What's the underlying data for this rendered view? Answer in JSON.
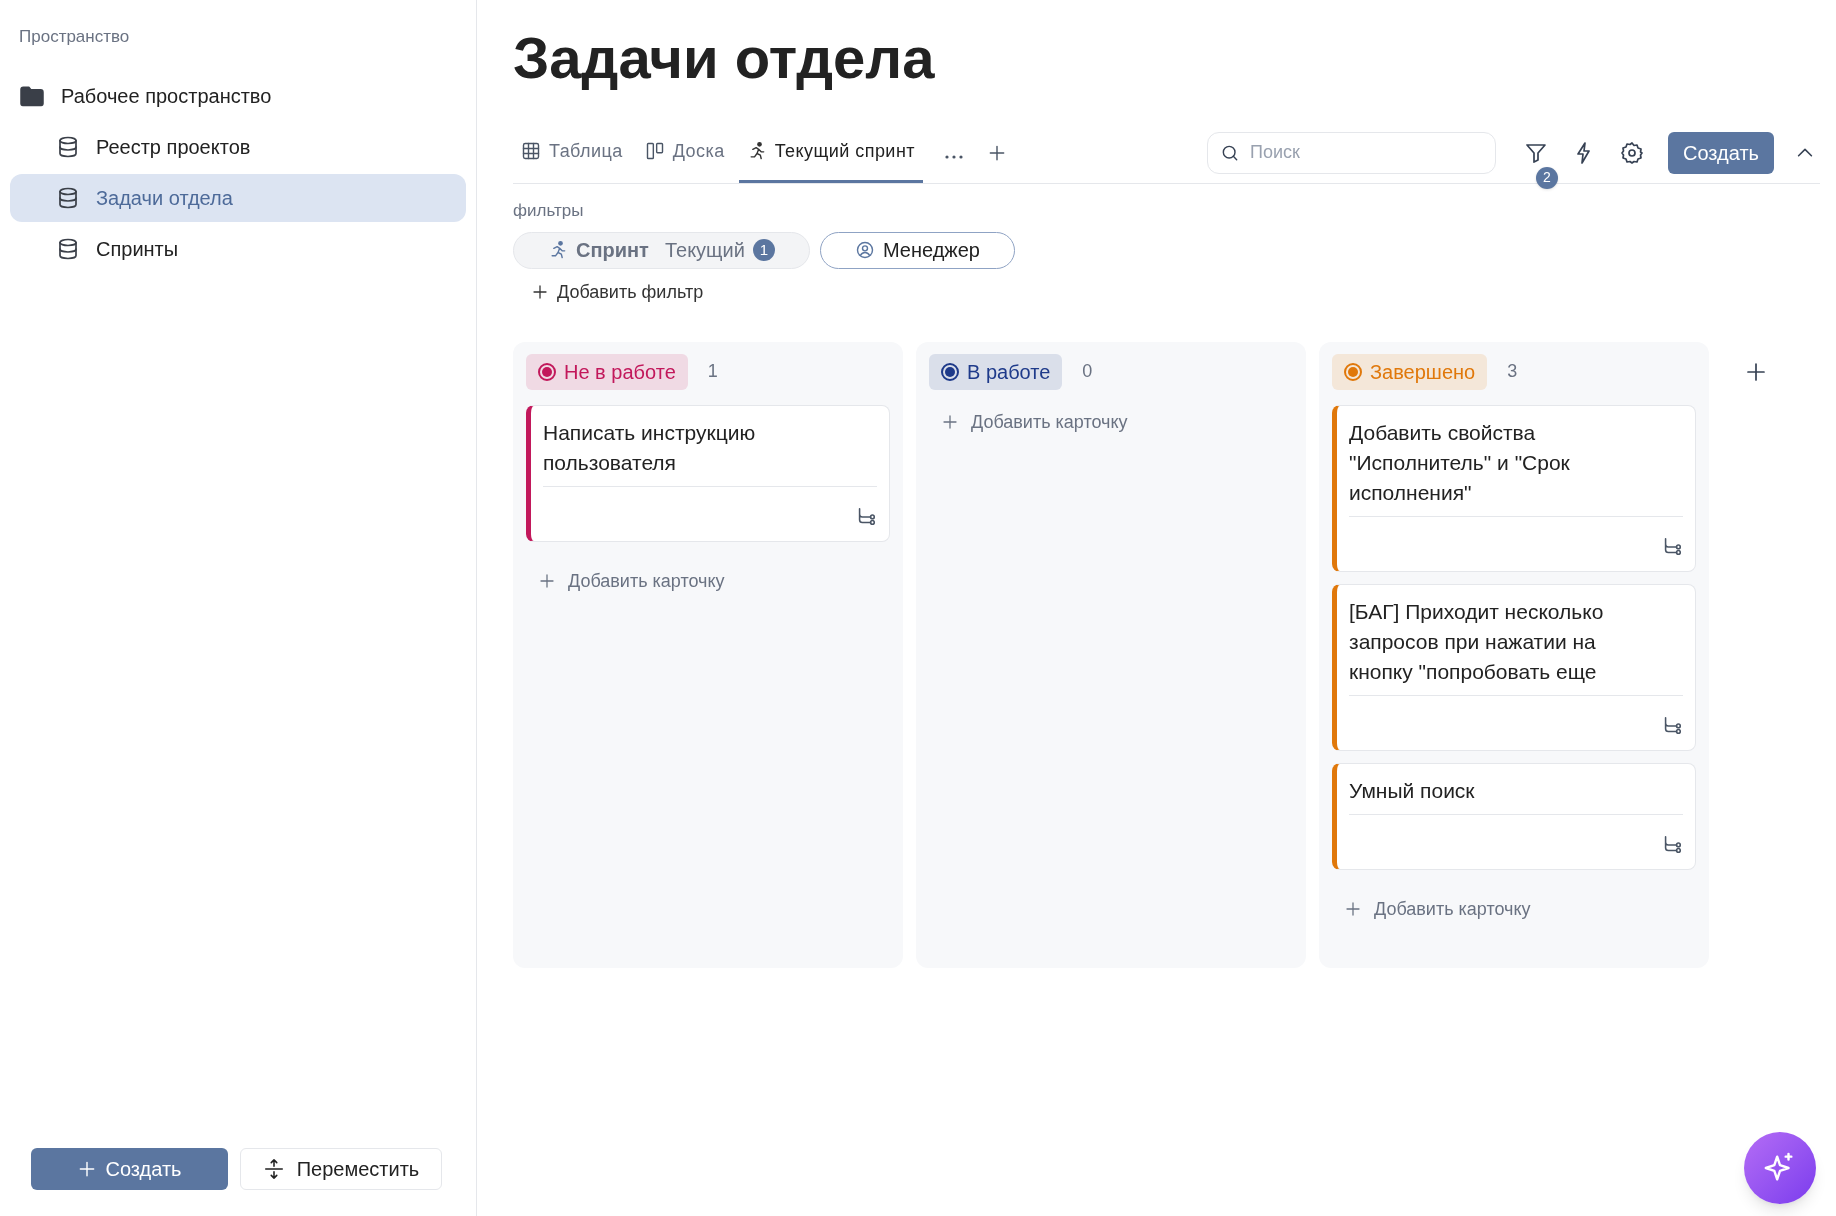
{
  "sidebar": {
    "section_label": "Пространство",
    "items": [
      {
        "label": "Рабочее пространство",
        "kind": "folder",
        "selected": false,
        "children": [
          {
            "label": "Реестр проектов",
            "kind": "database",
            "selected": false
          },
          {
            "label": "Задачи отдела",
            "kind": "database",
            "selected": true
          },
          {
            "label": "Спринты",
            "kind": "database",
            "selected": false
          }
        ]
      }
    ],
    "create_button": "Создать",
    "move_button": "Переместить"
  },
  "page": {
    "title": "Задачи отдела",
    "tabs": [
      {
        "label": "Таблица",
        "kind": "table",
        "selected": false
      },
      {
        "label": "Доска",
        "kind": "board",
        "selected": false
      },
      {
        "label": "Текущий спринт",
        "kind": "sprint",
        "selected": true
      }
    ],
    "search": {
      "placeholder": "Поиск"
    },
    "filter_count": "2",
    "create_button": "Создать",
    "filters": {
      "label": "фильтры",
      "chips": [
        {
          "kind": "sprint",
          "label": "Спринт",
          "value": "Текущий",
          "count": "1"
        },
        {
          "kind": "person",
          "label": "Менеджер"
        }
      ],
      "add_filter": "Добавить фильтр"
    },
    "columns": [
      {
        "label": "Не в работе",
        "count": "1",
        "color": "#c2185b",
        "cards": [
          {
            "title": "Написать инструкцию пользователя"
          }
        ],
        "add_card": "Добавить карточку"
      },
      {
        "label": "В работе",
        "count": "0",
        "color": "#1e3a8a",
        "add_card": "Добавить карточку"
      },
      {
        "label": "Завершено",
        "count": "3",
        "color": "#e0780b",
        "cards": [
          {
            "title": "Добавить свойства \"Исполнитель\" и \"Срок исполнения\""
          },
          {
            "title": "[БАГ] Приходит несколько запросов при нажатии на кнопку \"попробовать еще"
          },
          {
            "title": "Умный поиск"
          }
        ],
        "add_card": "Добавить карточку"
      }
    ]
  }
}
